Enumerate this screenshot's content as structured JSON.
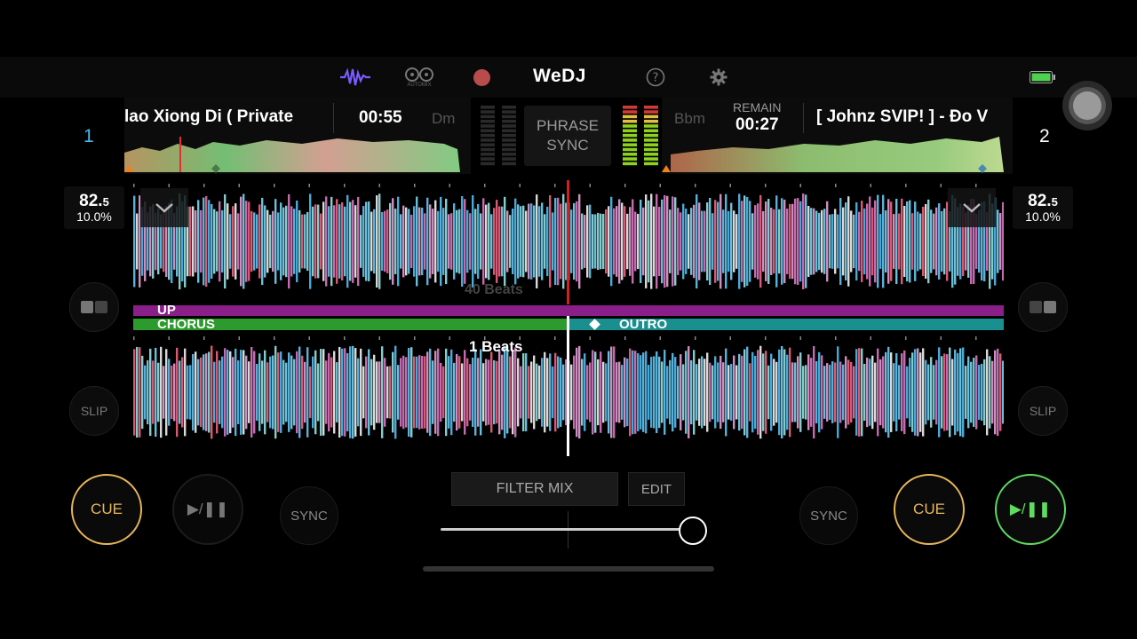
{
  "app": {
    "logo": "WeDJ",
    "automix_label": "AUTOMIX",
    "phrase_sync_line1": "PHRASE",
    "phrase_sync_line2": "SYNC"
  },
  "deck1": {
    "number": "1",
    "title": "lao Xiong Di ( Private",
    "time": "00:55",
    "key": "Dm",
    "bpm_main": "82.",
    "bpm_dec": "5",
    "pitch": "10.0%",
    "cue_label": "CUE",
    "play_label": "▶/❚❚",
    "sync_label": "SYNC",
    "slip_label": "SLIP"
  },
  "deck2": {
    "number": "2",
    "title": "[ Johnz SVIP! ] - Đo V",
    "remain_label": "REMAIN",
    "time": "00:27",
    "key": "Bbm",
    "bpm_main": "82.",
    "bpm_dec": "5",
    "pitch": "10.0%",
    "cue_label": "CUE",
    "play_label": "▶/❚❚",
    "sync_label": "SYNC",
    "slip_label": "SLIP"
  },
  "waveform": {
    "upper_beats": "40 Beats",
    "lower_beats": "1 Beats",
    "phrase_up": "UP",
    "phrase_chorus": "CHORUS",
    "phrase_outro": "OUTRO"
  },
  "mixer": {
    "filter_mix_label": "FILTER MIX",
    "edit_label": "EDIT",
    "crossfader_position": 1.0
  },
  "colors": {
    "cue": "#e7b65a",
    "play_active": "#5fdb5f",
    "deck1_number": "#4cb8e8",
    "phrase_purple": "#8a1f8a",
    "phrase_green": "#2c9a2c",
    "phrase_teal": "#1a8f8f"
  },
  "icons": [
    "waveform-icon",
    "automix-icon",
    "record-icon",
    "help-icon",
    "settings-icon",
    "battery-icon",
    "assistive-touch-icon",
    "chevron-down-icon",
    "layout-icon"
  ]
}
